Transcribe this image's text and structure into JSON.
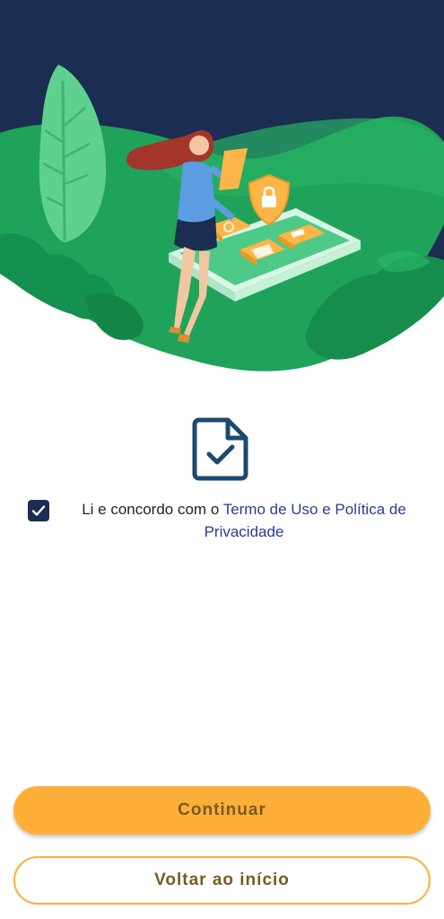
{
  "consent": {
    "prefix": "Li e concordo com o ",
    "link_line1": "Termo de Uso e Política de",
    "link_line2": "Privacidade",
    "checked": true
  },
  "buttons": {
    "continue_label": "Continuar",
    "back_label": "Voltar ao início"
  },
  "colors": {
    "navy": "#1c2d52",
    "green": "#1fa35a",
    "accent": "#fdaf38",
    "link": "#2b3c8f"
  },
  "icons": {
    "hero": "terms-security-illustration",
    "document": "document-check-icon",
    "checkbox": "check-icon"
  }
}
